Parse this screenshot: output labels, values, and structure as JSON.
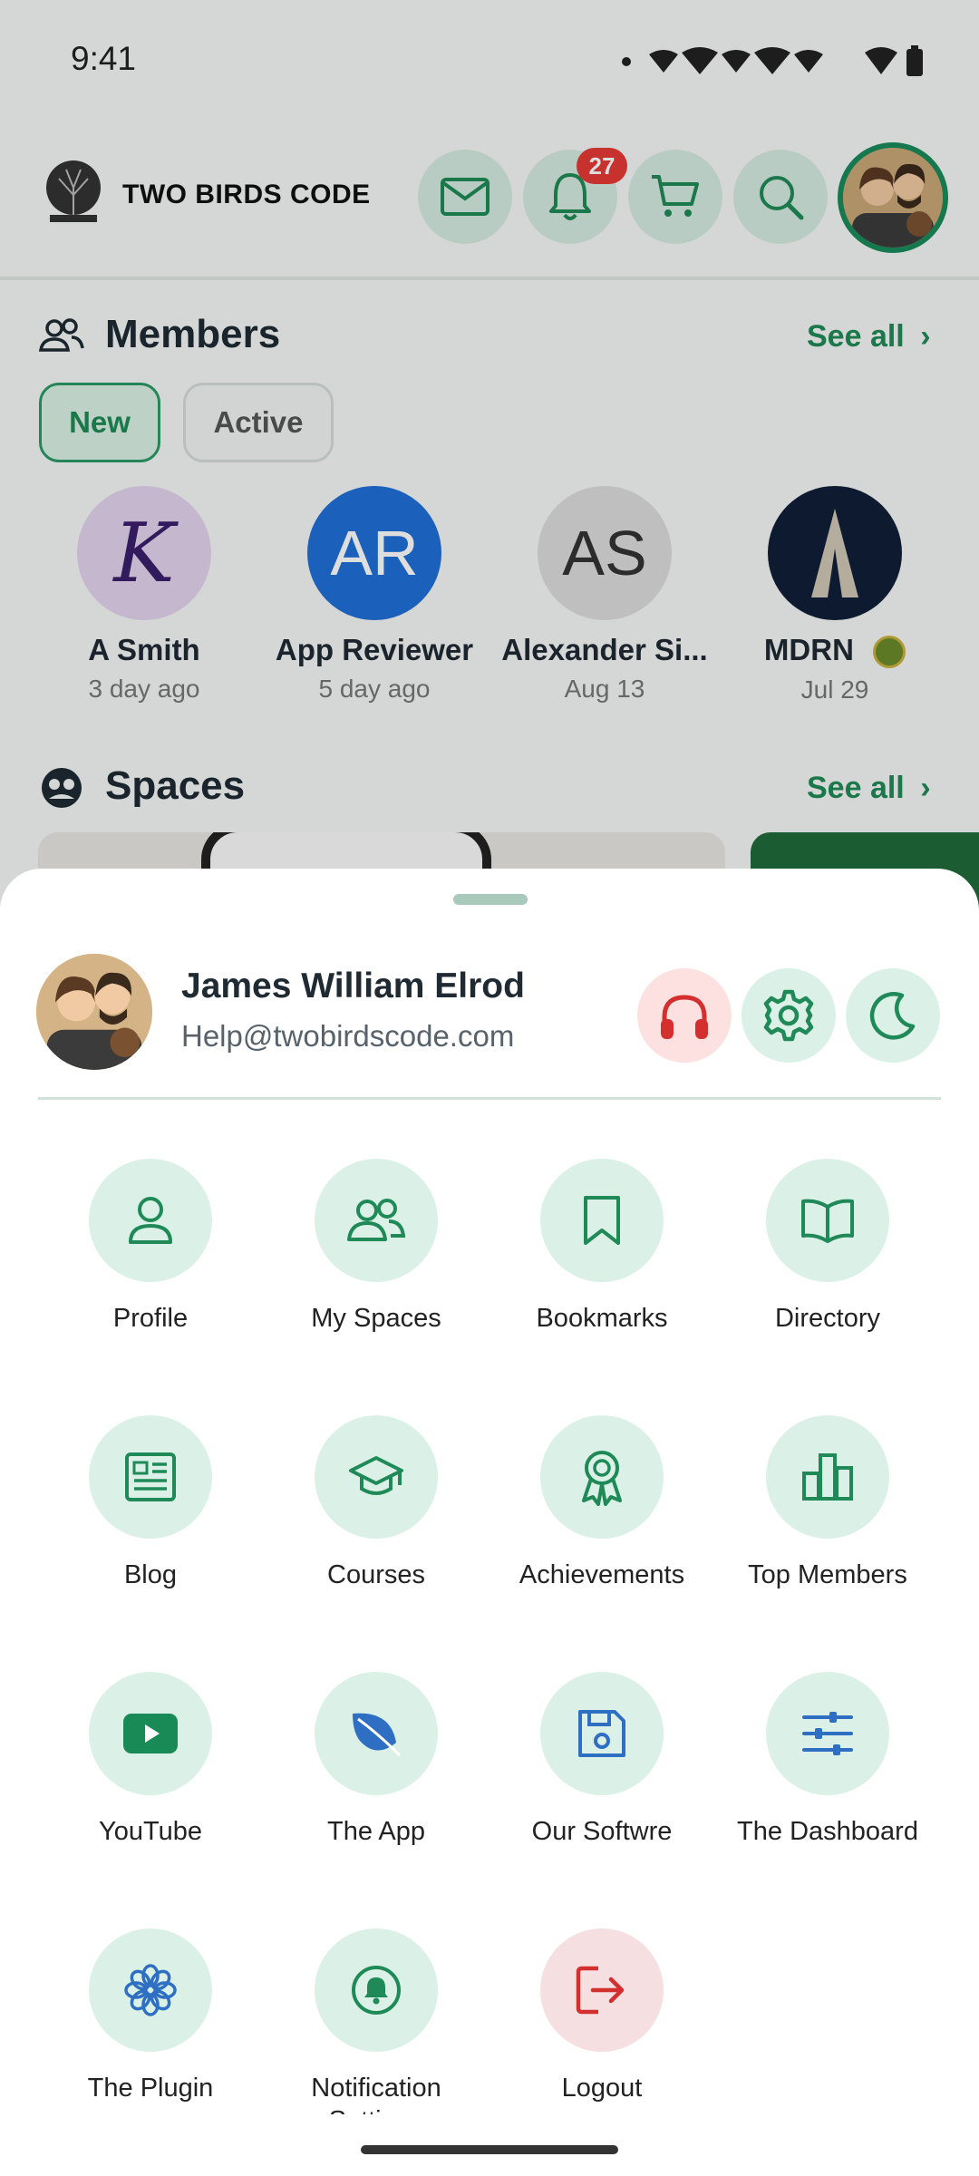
{
  "status_bar": {
    "time": "9:41"
  },
  "header": {
    "brand": "TWO BIRDS CODE",
    "notification_count": "27"
  },
  "members": {
    "title": "Members",
    "see_all": "See all",
    "filters": [
      "New",
      "Active"
    ],
    "list": [
      {
        "initials": "K",
        "name": "A Smith",
        "date": "3 day ago"
      },
      {
        "initials": "AR",
        "name": "App Reviewer",
        "date": "5 day ago"
      },
      {
        "initials": "AS",
        "name": "Alexander Si...",
        "date": "Aug 13"
      },
      {
        "initials": "",
        "name": "MDRN",
        "date": "Jul 29"
      }
    ]
  },
  "spaces": {
    "title": "Spaces",
    "see_all": "See all"
  },
  "sheet": {
    "user_name": "James William Elrod",
    "user_email": "Help@twobirdscode.com",
    "menu": [
      {
        "label": "Profile",
        "icon": "person-icon"
      },
      {
        "label": "My Spaces",
        "icon": "group-icon"
      },
      {
        "label": "Bookmarks",
        "icon": "bookmark-icon"
      },
      {
        "label": "Directory",
        "icon": "book-icon"
      },
      {
        "label": "Blog",
        "icon": "newspaper-icon"
      },
      {
        "label": "Courses",
        "icon": "graduation-cap-icon"
      },
      {
        "label": "Achievements",
        "icon": "award-icon"
      },
      {
        "label": "Top Members",
        "icon": "bar-chart-icon"
      },
      {
        "label": "YouTube",
        "icon": "youtube-icon"
      },
      {
        "label": "The App",
        "icon": "leaf-icon"
      },
      {
        "label": "Our Softwre",
        "icon": "floppy-disk-icon"
      },
      {
        "label": "The Dashboard",
        "icon": "sliders-icon"
      },
      {
        "label": "The Plugin",
        "icon": "flower-icon"
      },
      {
        "label": "Notification Settings",
        "icon": "bell-circle-icon"
      },
      {
        "label": "Logout",
        "icon": "logout-icon"
      }
    ]
  },
  "colors": {
    "accent": "#1f8a57",
    "icon_bg": "#dbf1e7",
    "danger": "#d32f2f",
    "badge": "#e53935"
  }
}
